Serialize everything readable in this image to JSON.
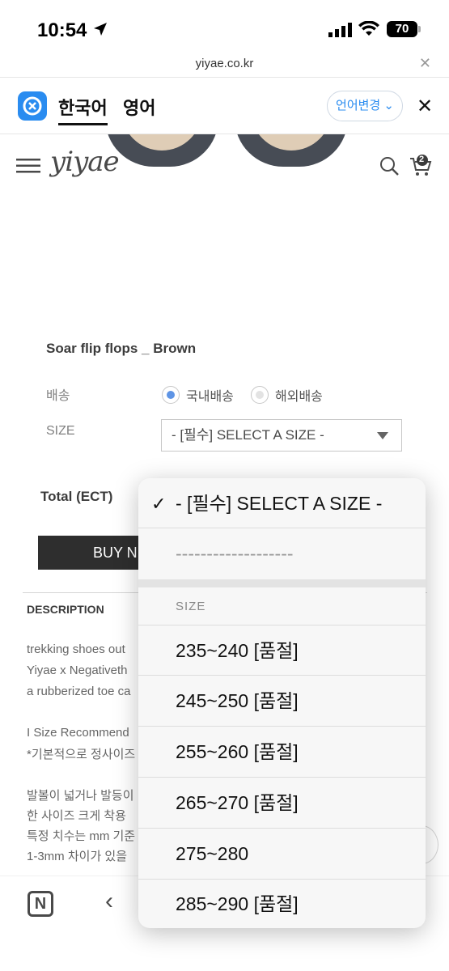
{
  "status": {
    "time": "10:54",
    "battery": "70"
  },
  "browser": {
    "url": "yiyae.co.kr"
  },
  "translate": {
    "source_lang": "한국어",
    "target_lang": "영어",
    "change_label": "언어변경"
  },
  "shop": {
    "logo": "yiyae",
    "cart_count": "2"
  },
  "product": {
    "title": "Soar flip flops _ Brown",
    "shipping_label": "배송",
    "shipping_options": [
      "국내배송",
      "해외배송"
    ],
    "size_label": "SIZE",
    "size_select_value": "- [필수] SELECT A SIZE -",
    "total_label": "Total (ECT)",
    "buy_label": "BUY N"
  },
  "description": {
    "title": "DESCRIPTION",
    "lines": [
      "trekking shoes out",
      "Yiyae x Negativeth",
      "a rubberized toe ca",
      "I Size Recommend",
      "*기본적으로 정사이즈",
      "발볼이 넓거나 발등이",
      "한 사이즈 크게 착용",
      "특정 치수는 mm 기준",
      "1-3mm 차이가 있을"
    ]
  },
  "picker": {
    "selected": "- [필수] SELECT A SIZE -",
    "separator": "-------------------",
    "group_label": "SIZE",
    "options": [
      "235~240 [품절]",
      "245~250 [품절]",
      "255~260 [품절]",
      "265~270 [품절]",
      "275~280",
      "285~290 [품절]"
    ]
  },
  "colors": {
    "accent": "#2a8cf0",
    "radio_on": "#3b7de0"
  }
}
